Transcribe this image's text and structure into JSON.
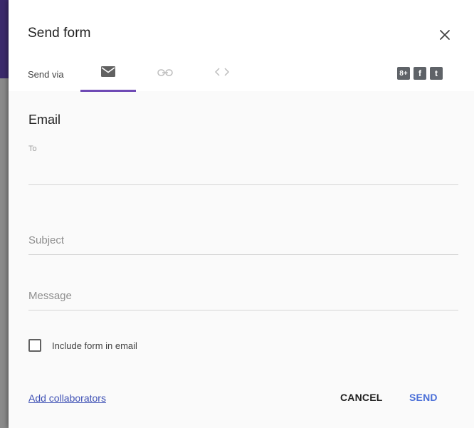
{
  "dialog": {
    "title": "Send form",
    "close_icon": "close-icon"
  },
  "send_via": {
    "label": "Send via",
    "tabs": [
      {
        "icon": "envelope-icon",
        "selected": true
      },
      {
        "icon": "link-icon",
        "selected": false
      },
      {
        "icon": "embed-code-icon",
        "selected": false
      }
    ],
    "share": [
      {
        "icon": "google-plus-icon",
        "glyph": "8+"
      },
      {
        "icon": "facebook-icon",
        "glyph": "f"
      },
      {
        "icon": "twitter-icon",
        "glyph": "t"
      }
    ]
  },
  "email": {
    "heading": "Email",
    "to_label": "To",
    "to_value": "",
    "subject_placeholder": "Subject",
    "message_placeholder": "Message",
    "include_label": "Include form in email",
    "include_checked": false
  },
  "footer": {
    "collaborators_link": "Add collaborators",
    "cancel_label": "CANCEL",
    "send_label": "SEND"
  },
  "colors": {
    "accent": "#6f4ab5",
    "send": "#4a6fd8",
    "link": "#3f51b5"
  }
}
